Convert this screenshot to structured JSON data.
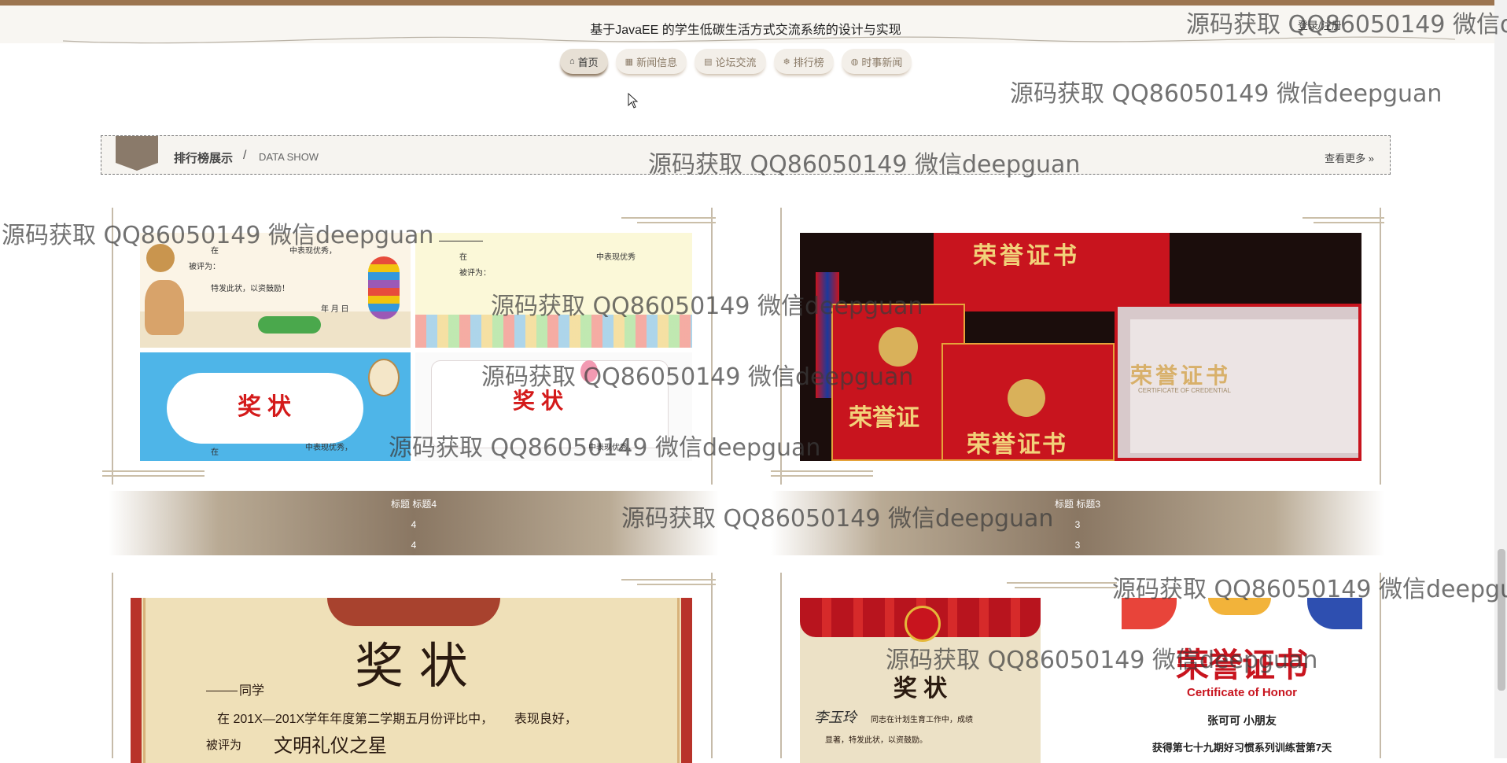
{
  "header": {
    "site_title": "基于JavaEE 的学生低碳生活方式交流系统的设计与实现",
    "login_label": "登录/注册"
  },
  "nav": {
    "items": [
      {
        "label": "首页",
        "icon": "home-icon",
        "active": true
      },
      {
        "label": "新闻信息",
        "icon": "news-icon",
        "active": false
      },
      {
        "label": "论坛交流",
        "icon": "forum-icon",
        "active": false
      },
      {
        "label": "排行榜",
        "icon": "rank-icon",
        "active": false
      },
      {
        "label": "时事新闻",
        "icon": "globe-icon",
        "active": false
      }
    ]
  },
  "section": {
    "title": "排行榜展示",
    "slash": "/",
    "subtitle": "DATA SHOW",
    "more_label": "查看更多",
    "more_icon": "double-chevron-right-icon"
  },
  "cards": [
    {
      "title": "标题 标题4",
      "line1": "4",
      "line2": "4",
      "image": "certificate-collage-image"
    },
    {
      "title": "标题 标题3",
      "line1": "3",
      "line2": "3",
      "image": "honor-certificate-red-image"
    }
  ],
  "images": {
    "collage": {
      "tile1_lines": [
        "在",
        "中表现优秀，",
        "被评为：",
        "特发此状，以资鼓励！",
        "年  月  日"
      ],
      "tile2_lines": [
        "在",
        "中表现优秀",
        "被评为："
      ],
      "tile3_title": "奖状",
      "tile3_lines": [
        "中表现优秀，",
        "在"
      ],
      "tile4_title": "奖状",
      "tile4_lines": [
        "中表现优秀，"
      ]
    },
    "red": {
      "top_text": "荣誉证书",
      "left_text": "荣誉证",
      "mid_text": "荣誉证书",
      "right_text": "荣誉证书",
      "right_sub": "CERTIFICATE OF CREDENTIAL"
    },
    "award": {
      "title": "奖 状",
      "line1": "同学",
      "line2": "在 201X—201X学年年度第二学期五月份评比中，      表现良好，",
      "line3_prefix": "被评为",
      "line3_main": "文明礼仪之星"
    },
    "small": {
      "title": "奖 状",
      "signature": "李玉玲",
      "line1": "同志在计划生育工作中，成绩",
      "line2": "显著，特发此状，以资鼓励。"
    },
    "honor": {
      "title": "荣誉证书",
      "subtitle": "Certificate of Honor",
      "name": "张可可 小朋友",
      "line": "获得第七十九期好习惯系列训练营第7天"
    }
  },
  "watermark": "源码获取 QQ86050149 微信deepguan",
  "colors": {
    "top_bar": "#9c7550",
    "accent_brown": "#8a7763",
    "certificate_red": "#c8141e"
  }
}
